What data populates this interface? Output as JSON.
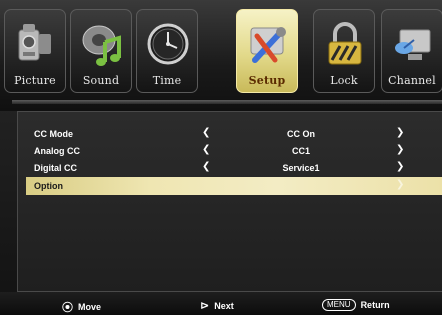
{
  "tabs": [
    {
      "label": "Picture",
      "icon": "camera-icon",
      "active": false
    },
    {
      "label": "Sound",
      "icon": "music-note-icon",
      "active": false
    },
    {
      "label": "Time",
      "icon": "clock-icon",
      "active": false
    },
    {
      "label": "Setup",
      "icon": "wrench-tools-icon",
      "active": true
    },
    {
      "label": "Lock",
      "icon": "padlock-icon",
      "active": false
    },
    {
      "label": "Channel",
      "icon": "satellite-dish-icon",
      "active": false
    }
  ],
  "menu": {
    "rows": [
      {
        "label": "CC Mode",
        "value": "CC On"
      },
      {
        "label": "Analog CC",
        "value": "CC1"
      },
      {
        "label": "Digital CC",
        "value": "Service1"
      },
      {
        "label": "Option",
        "value": ""
      }
    ],
    "selected_row": "Option",
    "left_arrow": "❮",
    "right_arrow": "❯"
  },
  "footer": {
    "move": {
      "glyph": "⦿",
      "label": "Move"
    },
    "next": {
      "glyph": "⊳",
      "label": "Next"
    },
    "return": {
      "key": "MENU",
      "label": "Return"
    }
  },
  "colors": {
    "selected_row": "#efe6b2",
    "active_tab": "#e2d98a",
    "panel_bg": "#262626"
  }
}
